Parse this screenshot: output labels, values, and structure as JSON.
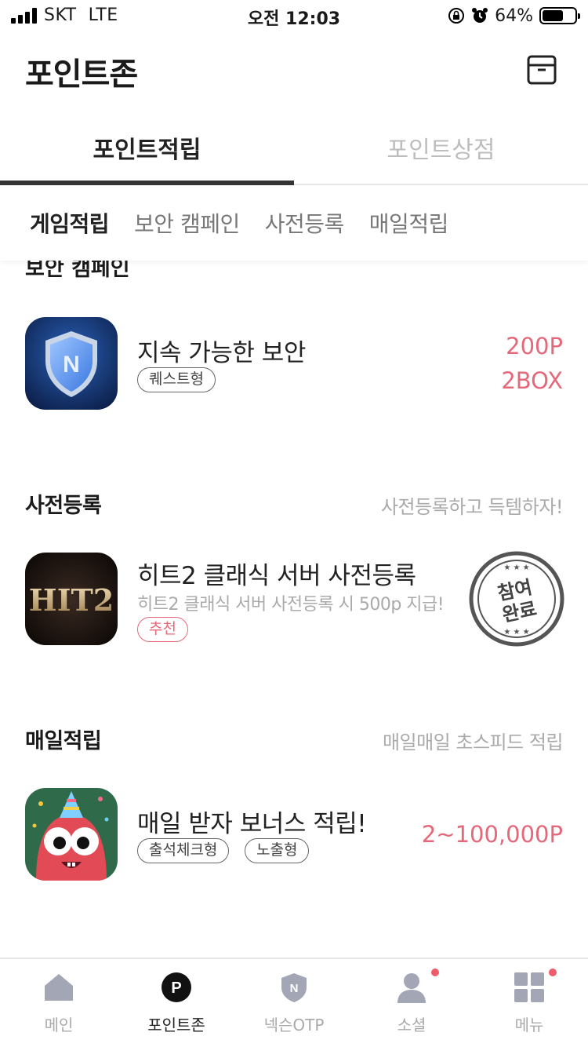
{
  "status_bar": {
    "carrier": "SKT",
    "network": "LTE",
    "time": "오전 12:03",
    "battery_percent": "64%",
    "battery_level": 0.64
  },
  "header": {
    "title": "포인트존",
    "box_icon": "storage-box-icon"
  },
  "main_tabs": [
    {
      "label": "포인트적립",
      "active": true
    },
    {
      "label": "포인트상점",
      "active": false
    }
  ],
  "sub_tabs": [
    {
      "label": "게임적립",
      "active": true
    },
    {
      "label": "보안 캠페인",
      "active": false
    },
    {
      "label": "사전등록",
      "active": false
    },
    {
      "label": "매일적립",
      "active": false
    }
  ],
  "sections": {
    "security": {
      "title": "보안 캠페인",
      "item": {
        "title": "지속 가능한 보안",
        "tags": [
          "퀘스트형"
        ],
        "rewards": [
          "200P",
          "2BOX"
        ]
      }
    },
    "preregister": {
      "title": "사전등록",
      "subtitle": "사전등록하고 득템하자!",
      "item": {
        "title": "히트2 클래식 서버 사전등록",
        "desc": "히트2 클래식 서버 사전등록 시 500p 지급!",
        "tags": [
          "추천"
        ],
        "icon_text": "HIT2",
        "stamp_line1": "참여",
        "stamp_line2": "완료"
      }
    },
    "daily": {
      "title": "매일적립",
      "subtitle": "매일매일 초스피드 적립",
      "item": {
        "title": "매일 받자 보너스 적립!",
        "tags": [
          "출석체크형",
          "노출형"
        ],
        "reward": "2~100,000P"
      }
    }
  },
  "bottom_nav": [
    {
      "label": "메인",
      "icon": "home-icon",
      "active": false,
      "badge": false
    },
    {
      "label": "포인트존",
      "icon": "point-icon",
      "active": true,
      "badge": false
    },
    {
      "label": "넥슨OTP",
      "icon": "otp-shield-icon",
      "active": false,
      "badge": false
    },
    {
      "label": "소셜",
      "icon": "person-icon",
      "active": false,
      "badge": true
    },
    {
      "label": "메뉴",
      "icon": "grid-menu-icon",
      "active": false,
      "badge": true
    }
  ],
  "colors": {
    "accent_pink": "#e5687a",
    "active_tab_underline": "#333333",
    "badge_dot": "#ee5b6c"
  }
}
